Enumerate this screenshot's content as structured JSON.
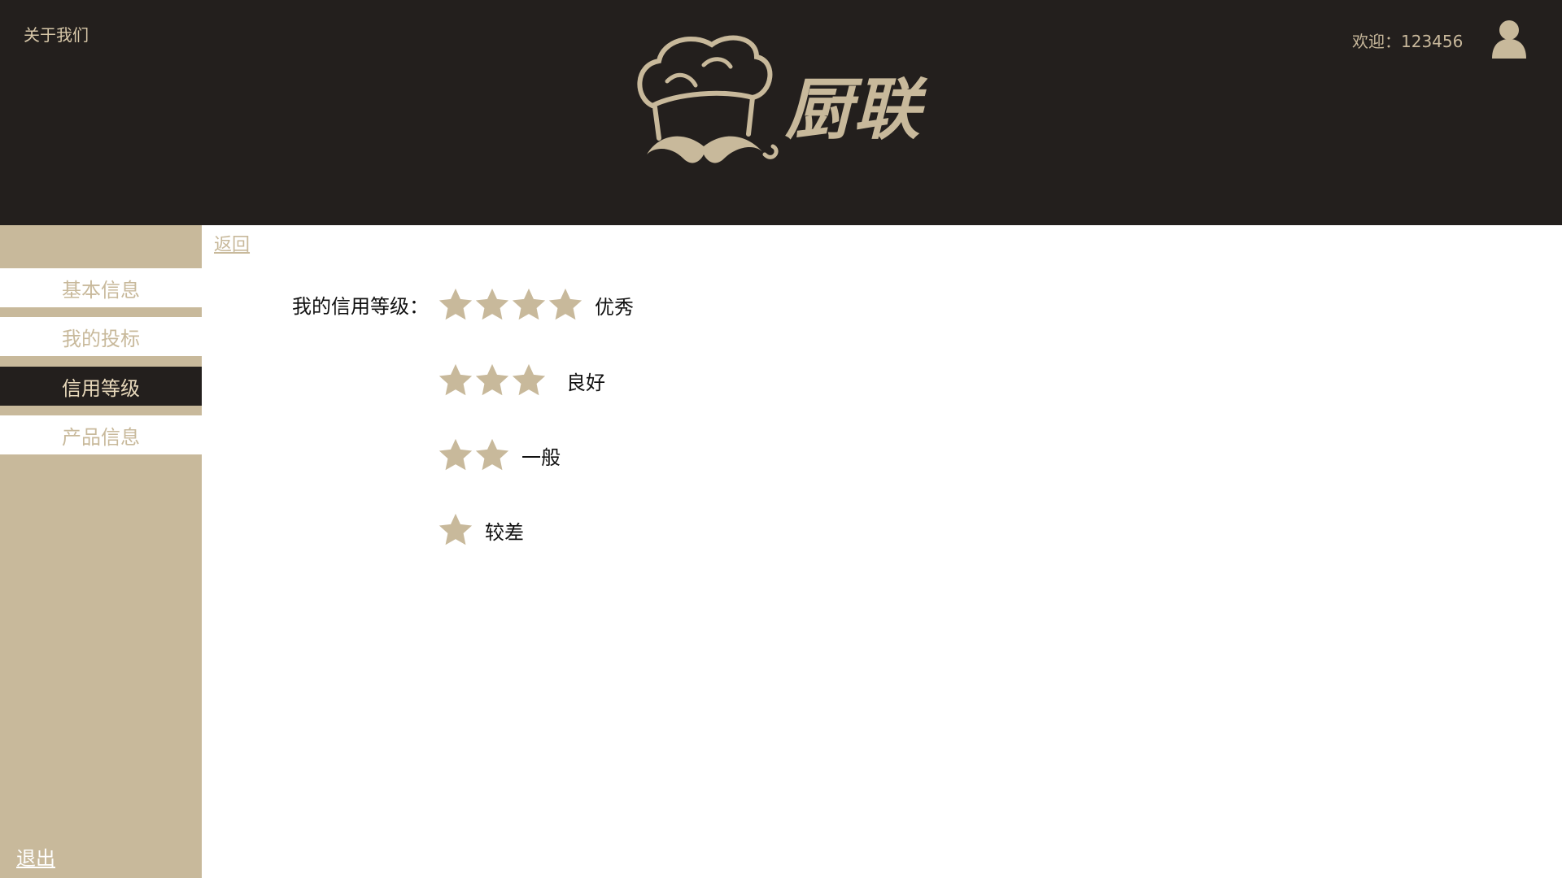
{
  "header": {
    "about_link": "关于我们",
    "brand_name": "厨联",
    "welcome_text": "欢迎：123456"
  },
  "sidebar": {
    "items": [
      {
        "label": "基本信息"
      },
      {
        "label": "我的投标"
      },
      {
        "label": "信用等级"
      },
      {
        "label": "产品信息"
      }
    ],
    "logout": "退出"
  },
  "main": {
    "back_link": "返回",
    "credit_label": "我的信用等级：",
    "levels": [
      {
        "stars": 4,
        "label": "优秀"
      },
      {
        "stars": 3,
        "label": "良好"
      },
      {
        "stars": 2,
        "label": "一般"
      },
      {
        "stars": 1,
        "label": "较差"
      }
    ]
  },
  "colors": {
    "header_bg": "#231f1d",
    "accent": "#c8b99b",
    "active_bg": "#231f1d"
  },
  "icons": [
    "chef-hat-logo-icon",
    "user-avatar-icon",
    "star-icon"
  ]
}
